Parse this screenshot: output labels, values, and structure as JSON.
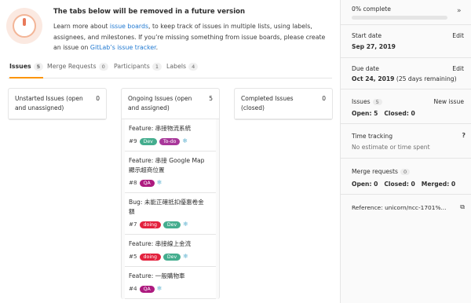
{
  "alert": {
    "title": "The tabs below will be removed in a future version",
    "body_1": "Learn more about ",
    "link_1": "issue boards",
    "body_2": ", to keep track of issues in multiple lists, using labels, assignees, and milestones. If you’re missing something from issue boards, please create an issue on ",
    "link_2": "GitLab’s issue tracker",
    "body_3": "."
  },
  "tabs": [
    {
      "label": "Issues",
      "count": "5"
    },
    {
      "label": "Merge Requests",
      "count": "0"
    },
    {
      "label": "Participants",
      "count": "1"
    },
    {
      "label": "Labels",
      "count": "4"
    }
  ],
  "columns": [
    {
      "title": "Unstarted Issues (open and unassigned)",
      "count": "0"
    },
    {
      "title": "Ongoing Issues (open and assigned)",
      "count": "5",
      "cards": [
        {
          "title": "Feature: 串接物流系統",
          "number": "#9",
          "labels": [
            "Dev",
            "To-do"
          ]
        },
        {
          "title": "Feature: 串接 Google Map 顯示超商位置",
          "number": "#8",
          "labels": [
            "QA"
          ]
        },
        {
          "title": "Bug: 未能正確抵扣優惠卷金額",
          "number": "#7",
          "labels": [
            "doing",
            "Dev"
          ]
        },
        {
          "title": "Feature: 串接線上金流",
          "number": "#5",
          "labels": [
            "doing",
            "Dev"
          ]
        },
        {
          "title": "Feature: 一般購物車",
          "number": "#4",
          "labels": [
            "QA"
          ]
        }
      ]
    },
    {
      "title": "Completed Issues (closed)",
      "count": "0"
    }
  ],
  "label_colors": {
    "Dev": "#44ad8e",
    "To-do": "#a8379a",
    "QA": "#ad1a7f",
    "doing": "#e3213d"
  },
  "sidebar": {
    "progress_text": "0% complete",
    "progress_value": 0,
    "collapse_icon": "»",
    "start_date": {
      "label": "Start date",
      "edit": "Edit",
      "value": "Sep 27, 2019"
    },
    "due_date": {
      "label": "Due date",
      "edit": "Edit",
      "value": "Oct 24, 2019",
      "remaining": "(25 days remaining)"
    },
    "issues": {
      "label": "Issues",
      "count": "5",
      "action": "New issue",
      "open": "Open: 5",
      "closed": "Closed: 0"
    },
    "time_tracking": {
      "label": "Time tracking",
      "help_icon": "?",
      "value": "No estimate or time spent"
    },
    "merge_requests": {
      "label": "Merge requests",
      "count": "0",
      "open": "Open: 0",
      "closed": "Closed: 0",
      "merged": "Merged: 0"
    },
    "reference": {
      "label": "Reference: ",
      "value": "unicorn/ncc-1701%..."
    }
  }
}
